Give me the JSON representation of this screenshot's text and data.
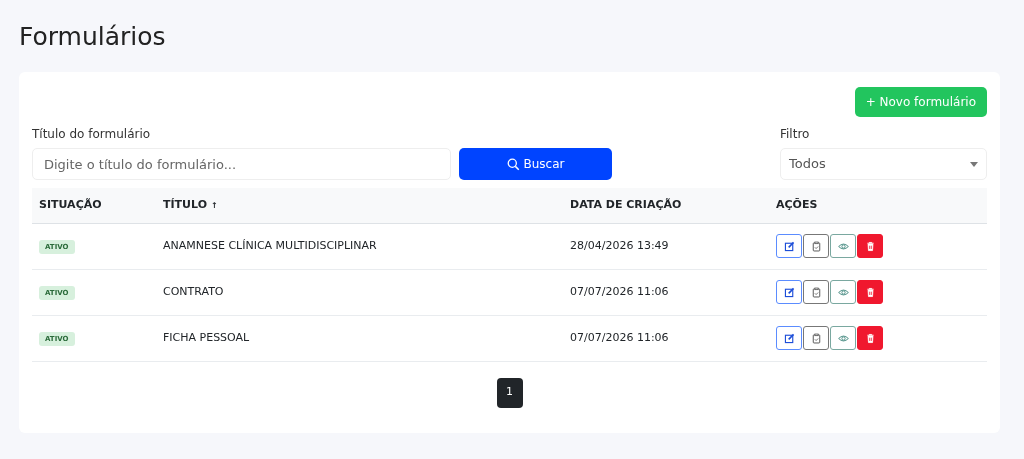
{
  "page_title": "Formulários",
  "new_button": {
    "icon": "+",
    "label": "Novo formulário"
  },
  "search": {
    "label": "Título do formulário",
    "placeholder": "Digite o título do formulário...",
    "button": "Buscar"
  },
  "filter": {
    "label": "Filtro",
    "value": "Todos"
  },
  "table": {
    "columns": [
      {
        "label": "SITUAÇÃO"
      },
      {
        "label": "TÍTULO",
        "sort_indicator": "↑"
      },
      {
        "label": "DATA DE CRIAÇÃO"
      },
      {
        "label": "AÇÕES"
      }
    ],
    "rows": [
      {
        "status": "ATIVO",
        "title": "ANAMNESE CLÍNICA MULTIDISCIPLINAR",
        "created": "28/04/2026 13:49"
      },
      {
        "status": "ATIVO",
        "title": "CONTRATO",
        "created": "07/07/2026 11:06"
      },
      {
        "status": "ATIVO",
        "title": "FICHA PESSOAL",
        "created": "07/07/2026 11:06"
      }
    ]
  },
  "pagination": [
    {
      "label": "1",
      "selected": true
    }
  ]
}
